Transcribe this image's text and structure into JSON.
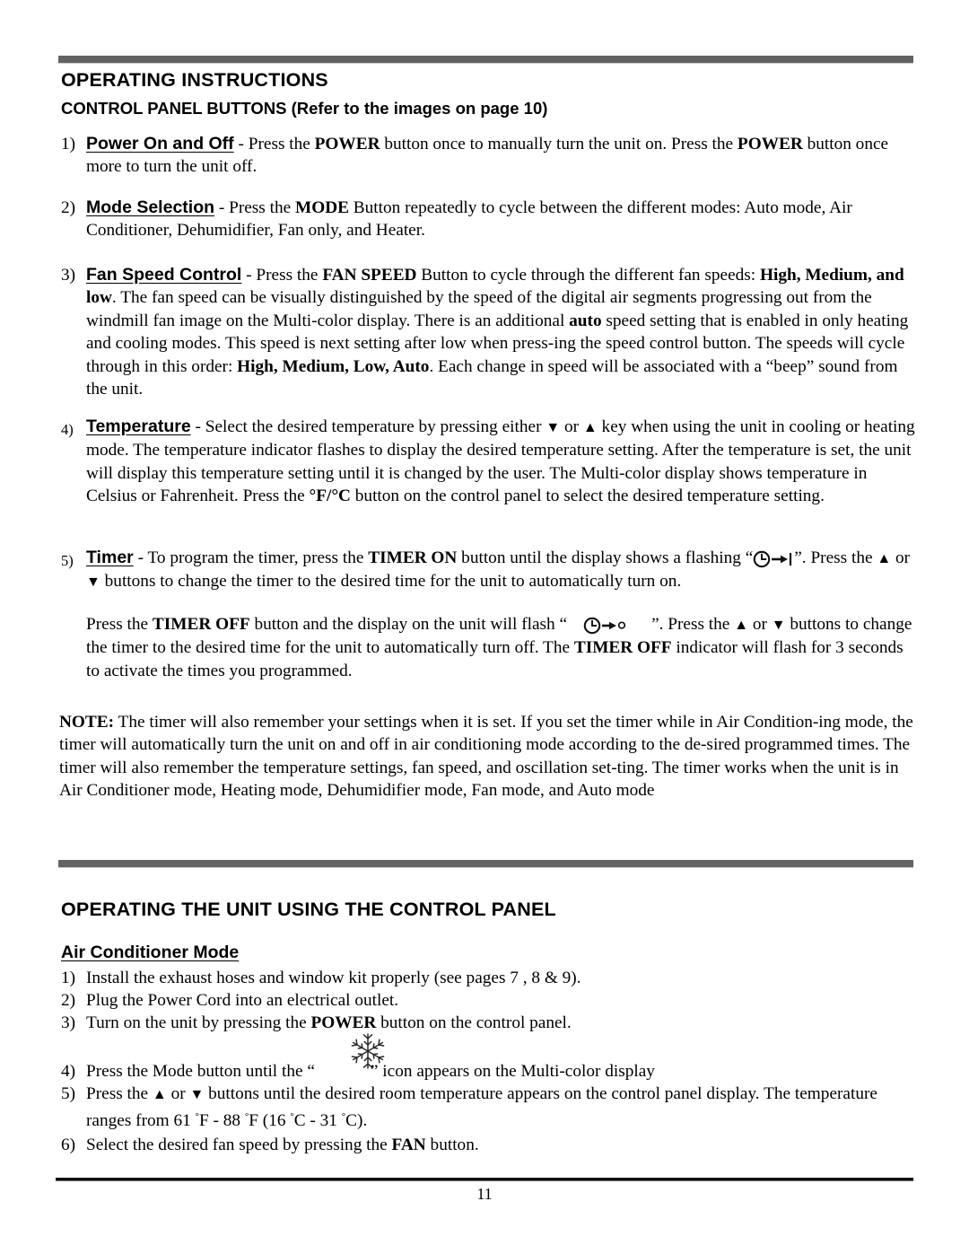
{
  "document": {
    "page_number": "11",
    "sections": [
      {
        "id": "operating-instructions",
        "heading": "OPERATING INSTRUCTIONS",
        "subheading": "CONTROL PANEL BUTTONS (Refer to the images on page 10)"
      },
      {
        "id": "operating-control-panel",
        "heading": "OPERATING THE UNIT USING THE CONTROL PANEL",
        "subheading": "Air Conditioner Mode"
      }
    ]
  },
  "control_panel_buttons": {
    "items": [
      {
        "number": "1)",
        "label": "Power On and Off",
        "text_1": " - Press the ",
        "bold_1": "POWER",
        "text_2": " button once to manually turn the unit on. Press the ",
        "bold_2": "POWER",
        "text_3": " button once more to turn the unit off."
      },
      {
        "number": "2)",
        "label": "Mode Selection",
        "text_1": " - Press the ",
        "bold_1": "MODE",
        "text_2": " Button repeatedly to cycle between the different modes: Auto mode, Air Conditioner, Dehumidifier, Fan only, and Heater."
      },
      {
        "number": "3)",
        "label": "Fan Speed Control",
        "text_1": " - Press the ",
        "bold_1": "FAN SPEED",
        "text_2": " Button to cycle through the different fan speeds: ",
        "bold_2": "High, Medium, and low",
        "text_3": ". The fan speed can be visually distinguished by the speed of the digital air segments progressing out from the windmill fan image on the Multi-color display. There is an additional ",
        "bold_3": "auto",
        "text_4": " speed setting that is enabled in only heating and cooling modes. This speed is next setting after low when press-ing the speed control button. The speeds will cycle through in this order: ",
        "bold_4": "High, Medium, Low, Auto",
        "text_5": ". Each change in speed will be associated with a “beep” sound from the unit."
      },
      {
        "number": "4)",
        "label": "Temperature",
        "text_1": " - Select the desired temperature by pressing either ",
        "glyph_down": "▼",
        "text_2": " or ",
        "glyph_up": "▲",
        "text_3": " key when using the unit in cooling or heating mode. The temperature indicator flashes to display the desired temperature setting. After the temperature is set, the unit will display this temperature setting until it is changed by the user. The Multi-color display shows temperature in Celsius or Fahrenheit.  Press the ",
        "bold_1": "°F/°C",
        "text_4": " button on the control panel to select the desired temperature setting."
      },
      {
        "number": "5)",
        "label": "Timer",
        "text_1": " - To program the timer, press the ",
        "bold_1": "TIMER ON",
        "text_2": " button until the display shows a flashing “",
        "icon_1": "timer-on-icon",
        "text_3": "”. Press the ",
        "glyph_up": "▲",
        "text_4": " or  ",
        "glyph_down": "▼",
        "text_5": " buttons to change the timer to the desired time for the unit to automatically turn on.",
        "para2_text_1": "Press the ",
        "para2_bold_1": "TIMER OFF",
        "para2_text_2": " button and the display on the unit will flash “",
        "icon_2": "timer-off-icon",
        "para2_text_3": "”.  Press the ",
        "para2_glyph_up": "▲",
        "para2_text_4": " or  ",
        "para2_glyph_down": "▼",
        "para2_text_5": " buttons to change the timer to the desired time for the unit to automatically turn off.  The ",
        "para2_bold_2": "TIMER OFF",
        "para2_text_6": " indicator will flash for 3 seconds to activate the times you programmed."
      }
    ]
  },
  "note": {
    "lead": "NOTE:",
    "text": " The timer will also remember your settings when it is set. If you set the timer while in Air Condition-ing mode, the timer will automatically turn the unit on and off in air conditioning mode according to the de-sired programmed times. The timer will also remember the temperature settings, fan speed, and oscillation set-ting. The timer works when the unit is in Air Conditioner mode, Heating mode, Dehumidifier mode, Fan mode, and Auto mode"
  },
  "air_conditioner_mode": {
    "items": [
      {
        "number": "1)",
        "text_1": "Install the exhaust hoses and window kit properly (see pages 7 , 8 & 9)."
      },
      {
        "number": "2)",
        "text_1": "Plug the Power Cord into an electrical outlet."
      },
      {
        "number": "3)",
        "text_1": "Turn on the unit by pressing the ",
        "bold_1": "POWER",
        "text_2": " button on the control panel."
      },
      {
        "number": "4)",
        "text_1": "Press the Mode button until the “",
        "icon_1": "snowflake-icon",
        "text_2": "” icon appears on the Multi-color display"
      },
      {
        "number": "5)",
        "text_1": "Press the ",
        "glyph_up": "▲",
        "text_2": " or ",
        "glyph_down": "▼",
        "text_3": " buttons until the desired room temperature appears on the control panel display.  The temperature ranges from 61 ",
        "deg_1": "°",
        "text_4": "F - 88 ",
        "deg_2": "°",
        "text_5": "F (16 ",
        "deg_3": "°",
        "text_6": "C - 31 ",
        "deg_4": "°",
        "text_7": "C)."
      },
      {
        "number": "6)",
        "text_1": "Select the desired fan speed by pressing the ",
        "bold_1": "FAN",
        "text_2": " button."
      }
    ]
  },
  "colors": {
    "rule_gray": "#636363",
    "rule_black": "#0c0c0c",
    "text": "#000000"
  }
}
